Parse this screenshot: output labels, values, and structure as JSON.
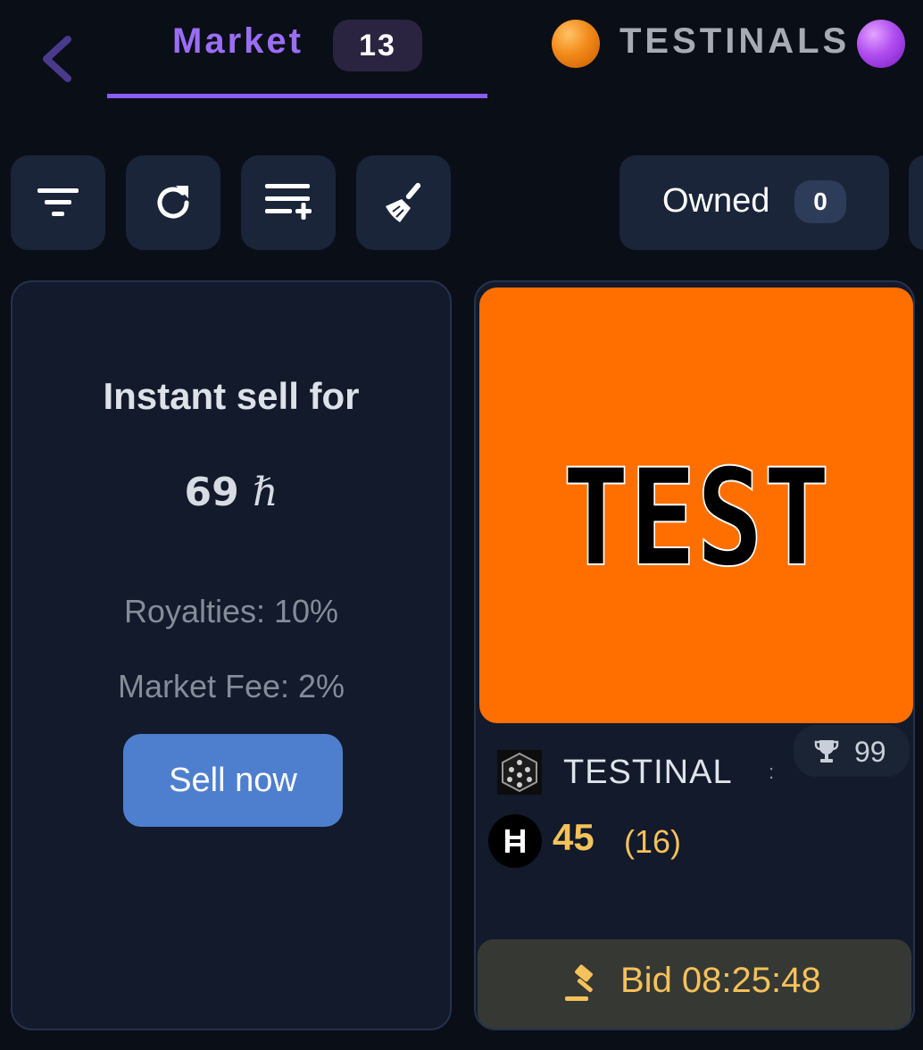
{
  "header": {
    "back_icon": "chevron-left-icon",
    "market_tab": {
      "label": "Market",
      "count": "13"
    },
    "collection": {
      "name": "TESTINALS",
      "left_orb_color": "#f28a1a",
      "right_orb_color": "#b04ef0"
    },
    "accent_color": "#8b5cf6"
  },
  "toolbar": {
    "buttons": [
      {
        "icon": "filter-icon"
      },
      {
        "icon": "refresh-icon"
      },
      {
        "icon": "add-list-icon"
      },
      {
        "icon": "broom-icon"
      }
    ],
    "owned": {
      "label": "Owned",
      "count": "0"
    }
  },
  "sell_panel": {
    "title": "Instant sell for",
    "price_value": "69",
    "price_symbol": "ℏ",
    "royalties": "Royalties: 10%",
    "market_fee": "Market Fee: 2%",
    "button_label": "Sell now",
    "button_color": "#4e7fce"
  },
  "nft_card": {
    "image_text": "TEST",
    "image_background": "#ff6f00",
    "collection_icon": "collection-cube-icon",
    "name": "TESTINAL",
    "menu": ":",
    "rank": "99",
    "rank_icon": "trophy-icon",
    "currency_icon": "hbar-icon",
    "price": "45",
    "price_count": "(16)",
    "bid_icon": "gavel-icon",
    "bid_label": "Bid 08:25:48",
    "price_color": "#f5c15a"
  }
}
